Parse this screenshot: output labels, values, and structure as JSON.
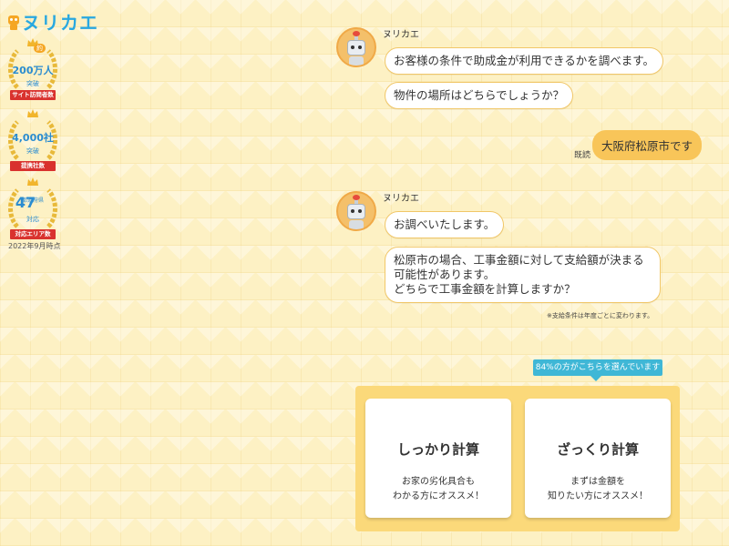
{
  "logo": {
    "text": "ヌリカエ"
  },
  "awards": [
    {
      "number": "200万人",
      "sub": "突破",
      "ribbon": "サイト訪問者数",
      "tag": "約"
    },
    {
      "number": "4,000社",
      "sub": "突破",
      "ribbon": "提携社数"
    },
    {
      "number": "47",
      "number_suffix": "都道府県",
      "sub": "対応",
      "ribbon": "対応エリア数"
    }
  ],
  "as_of": "2022年9月時点",
  "chat": {
    "bot_name": "ヌリカエ",
    "block1": [
      "お客様の条件で助成金が利用できるかを調べます。",
      "物件の場所はどちらでしょうか？"
    ],
    "user_read_label": "既読",
    "user_message": "大阪府松原市です",
    "block2": [
      "お調べいたします。",
      "松原市の場合、工事金額に対して支給額が決まる可能性があります。",
      "どちらで工事金額を計算しますか？"
    ],
    "note": "※支給条件は年度ごとに変わります。"
  },
  "choices": {
    "popular_badge": "84%の方がこちらを選んでいます",
    "options": [
      {
        "title": "しっかり計算",
        "desc_line1": "お家の劣化具合も",
        "desc_line2": "わかる方にオススメ！"
      },
      {
        "title": "ざっくり計算",
        "desc_line1": "まずは金額を",
        "desc_line2": "知りたい方にオススメ！"
      }
    ]
  },
  "colors": {
    "background": "#fdf1c4",
    "logo_blue": "#29a8e0",
    "user_bubble": "#f8c559",
    "badge_teal": "#3fb7d6",
    "panel": "#fbd97a",
    "ribbon_red": "#d9322e"
  }
}
